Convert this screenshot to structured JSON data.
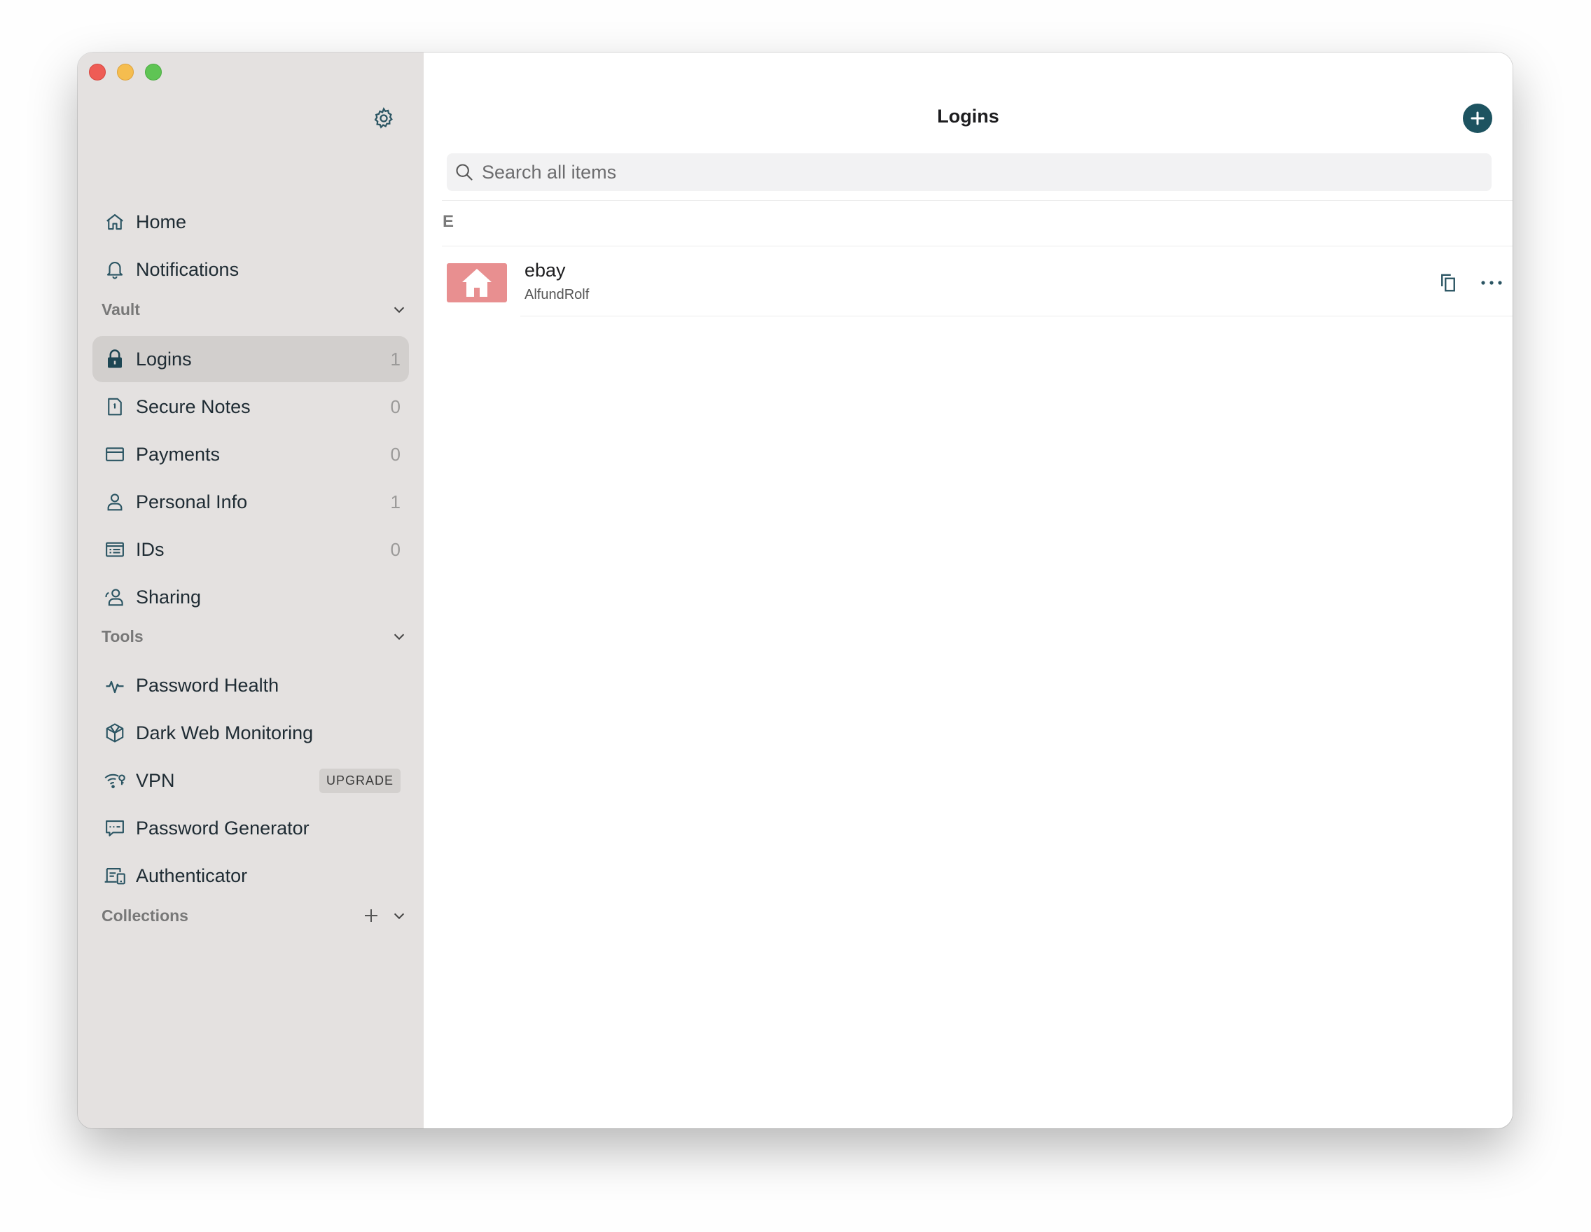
{
  "window": {
    "controls": [
      "close",
      "minimize",
      "maximize"
    ]
  },
  "sidebar": {
    "settings_icon": "gear-icon",
    "top_items": [
      {
        "label": "Home",
        "icon": "home-icon"
      },
      {
        "label": "Notifications",
        "icon": "bell-icon"
      }
    ],
    "vault": {
      "title": "Vault",
      "items": [
        {
          "label": "Logins",
          "count": "1",
          "icon": "lock-icon",
          "active": true
        },
        {
          "label": "Secure Notes",
          "count": "0",
          "icon": "note-icon"
        },
        {
          "label": "Payments",
          "count": "0",
          "icon": "card-icon"
        },
        {
          "label": "Personal Info",
          "count": "1",
          "icon": "person-icon"
        },
        {
          "label": "IDs",
          "count": "0",
          "icon": "id-card-icon"
        },
        {
          "label": "Sharing",
          "icon": "sharing-icon"
        }
      ]
    },
    "tools": {
      "title": "Tools",
      "items": [
        {
          "label": "Password Health",
          "icon": "pulse-icon"
        },
        {
          "label": "Dark Web Monitoring",
          "icon": "dark-web-icon"
        },
        {
          "label": "VPN",
          "icon": "vpn-icon",
          "badge": "UPGRADE"
        },
        {
          "label": "Password Generator",
          "icon": "generator-icon"
        },
        {
          "label": "Authenticator",
          "icon": "authenticator-icon"
        }
      ]
    },
    "collections": {
      "title": "Collections"
    }
  },
  "main": {
    "title": "Logins",
    "search": {
      "placeholder": "Search all items"
    },
    "group_letter": "E",
    "items": [
      {
        "name": "ebay",
        "username": "AlfundRolf",
        "thumbnail_color": "#e88f90"
      }
    ]
  },
  "colors": {
    "accent": "#1d5360",
    "sidebar_bg": "#e4e1e0",
    "active_item_bg": "#d2cfcd",
    "icon": "#2b5563"
  }
}
